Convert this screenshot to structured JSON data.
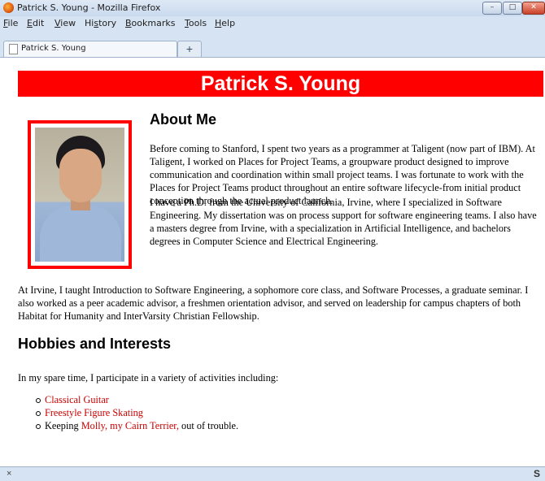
{
  "window": {
    "title": "Patrick S. Young - Mozilla Firefox",
    "minimize": "–",
    "maximize": "□",
    "close": "✕"
  },
  "menu": [
    {
      "ul": "F",
      "rest": "ile"
    },
    {
      "ul": "E",
      "rest": "dit"
    },
    {
      "ul": "V",
      "rest": "iew"
    },
    {
      "pre": "Hi",
      "ul": "s",
      "rest": "tory"
    },
    {
      "ul": "B",
      "rest": "ookmarks"
    },
    {
      "ul": "T",
      "rest": "ools"
    },
    {
      "ul": "H",
      "rest": "elp"
    }
  ],
  "tabs": {
    "active_title": "Patrick S. Young",
    "new_tab": "+"
  },
  "page": {
    "banner": "Patrick S. Young",
    "about_heading": "About Me",
    "p1": "Before coming to Stanford, I spent two years as a programmer at Taligent (now part of IBM). At Taligent, I worked on Places for Project Teams, a groupware product designed to improve communication and coordination within small project teams. I was fortunate to work with the Places for Project Teams product throughout an entire software lifecycle-from initial product conception through the actual product launch.",
    "p2": "I have a Ph.D. from the University of California, Irvine, where I specialized in Software Engineering. My dissertation was on process support for software engineering teams. I also have a masters degree from Irvine, with a specialization in Artificial Intelligence, and bachelors degrees in Computer Science and Electrical Engineering.",
    "p3": "At Irvine, I taught Introduction to Software Engineering, a sophomore core class, and Software Processes, a graduate seminar. I also worked as a peer academic advisor, a freshmen orientation advisor, and served on leadership for campus chapters of both Habitat for Humanity and InterVarsity Christian Fellowship.",
    "hobbies_heading": "Hobbies and Interests",
    "hobbies_intro": "In my spare time, I participate in a variety of activities including:",
    "hobby1": "Classical Guitar",
    "hobby2": "Freestyle Figure Skating",
    "hobby3_pre": "Keeping ",
    "hobby3_link": "Molly, my Cairn Terrier,",
    "hobby3_post": " out of trouble."
  },
  "status": {
    "close": "×",
    "right_icon": "S"
  }
}
